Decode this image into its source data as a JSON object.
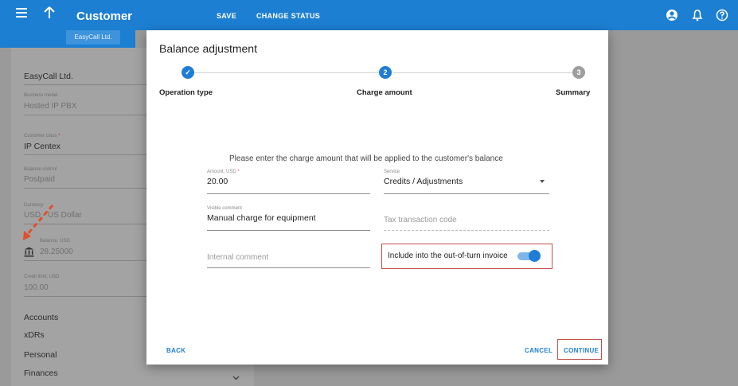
{
  "appbar": {
    "title": "Customer",
    "save_label": "SAVE",
    "change_status_label": "CHANGE STATUS",
    "icons": [
      "menu-icon",
      "arrow-up-icon",
      "account-icon",
      "bell-icon",
      "help-icon"
    ],
    "color": "#1d7fd2"
  },
  "subtab": {
    "label": "EasyCall Ltd."
  },
  "panel": {
    "customer_name": "EasyCall Ltd.",
    "business_model": {
      "label": "Business model",
      "value": "Hosted IP PBX"
    },
    "customer_class": {
      "label": "Customer class",
      "required": "*",
      "value": "IP Centex"
    },
    "balance_control": {
      "label": "Balance control",
      "value": "Postpaid"
    },
    "currency": {
      "label": "Currency",
      "value": "USD - US Dollar"
    },
    "balance": {
      "label": "Balance, USD",
      "value": "28.25000"
    },
    "credit_limit": {
      "label": "Credit limit, USD",
      "value": "100.00"
    },
    "nav": [
      "Accounts",
      "xDRs",
      "Personal",
      "Finances"
    ]
  },
  "dialog": {
    "title": "Balance adjustment",
    "steps": [
      {
        "label": "Operation type",
        "marker": "✓",
        "state": "done"
      },
      {
        "label": "Charge amount",
        "marker": "2",
        "state": "active"
      },
      {
        "label": "Summary",
        "marker": "3",
        "state": "pending"
      }
    ],
    "intro": "Please enter the charge amount that will be applied to the customer's balance",
    "amount": {
      "label": "Amount, USD",
      "required": "*",
      "value": "20.00"
    },
    "service": {
      "label": "Service",
      "value": "Credits / Adjustments"
    },
    "visible_comment": {
      "label": "Visible comment",
      "value": "Manual charge for equipment"
    },
    "tax_code": {
      "placeholder": "Tax transaction code"
    },
    "internal_comment": {
      "placeholder": "Internal comment"
    },
    "invoice_toggle": {
      "label": "Include into the out-of-turn invoice",
      "on": true
    },
    "back_label": "BACK",
    "cancel_label": "CANCEL",
    "continue_label": "CONTINUE"
  },
  "colors": {
    "accent": "#1e7ed6",
    "highlight": "#c0504d",
    "annotation_arrow": "#e0502a"
  }
}
